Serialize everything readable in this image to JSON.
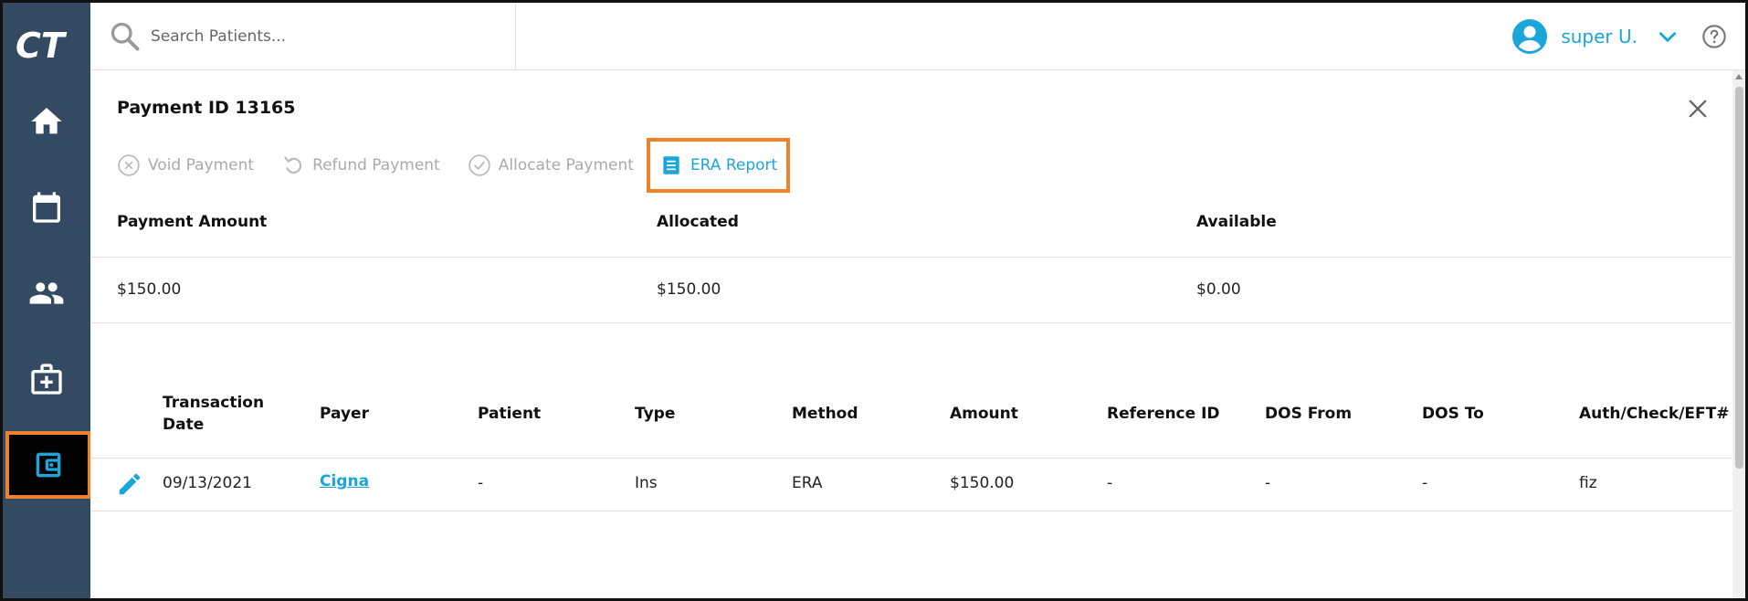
{
  "app": {
    "logo_text": "CT"
  },
  "search": {
    "placeholder": "Search Patients..."
  },
  "user": {
    "name": "super U."
  },
  "sidebar": {
    "items": [
      {
        "icon": "home-icon"
      },
      {
        "icon": "calendar-icon"
      },
      {
        "icon": "people-icon"
      },
      {
        "icon": "medical-kit-icon"
      },
      {
        "icon": "wallet-icon",
        "active": true
      }
    ]
  },
  "page": {
    "title": "Payment ID 13165"
  },
  "actions": {
    "void": "Void Payment",
    "refund": "Refund Payment",
    "allocate": "Allocate Payment",
    "era": "ERA Report"
  },
  "summary": {
    "payment_amount_label": "Payment Amount",
    "allocated_label": "Allocated",
    "available_label": "Available",
    "payment_amount": "$150.00",
    "allocated": "$150.00",
    "available": "$0.00"
  },
  "table": {
    "headers": {
      "transaction_date_1": "Transaction",
      "transaction_date_2": "Date",
      "payer": "Payer",
      "patient": "Patient",
      "type": "Type",
      "method": "Method",
      "amount": "Amount",
      "reference_id": "Reference ID",
      "dos_from": "DOS From",
      "dos_to": "DOS To",
      "auth": "Auth/Check/EFT#"
    },
    "rows": [
      {
        "transaction_date": "09/13/2021",
        "payer": "Cigna",
        "patient": "-",
        "type": "Ins",
        "method": "ERA",
        "amount": "$150.00",
        "reference_id": "-",
        "dos_from": "-",
        "dos_to": "-",
        "auth": "fiz"
      }
    ]
  },
  "colors": {
    "sidebar_bg": "#334a62",
    "accent": "#1aa6d8",
    "highlight": "#f0802a"
  }
}
